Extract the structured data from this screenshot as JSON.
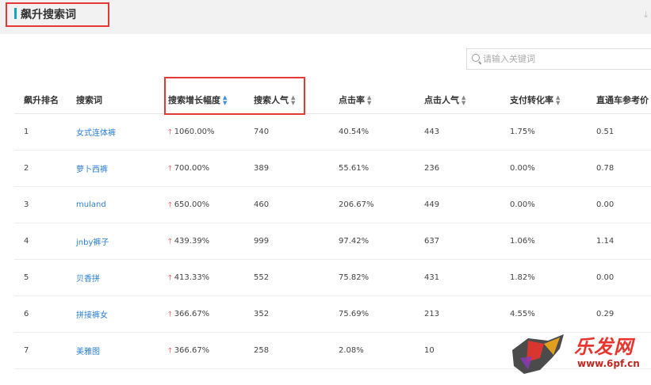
{
  "header": {
    "title": "飙升搜索词"
  },
  "search": {
    "placeholder": "请输入关键词"
  },
  "table": {
    "columns": [
      "飙升排名",
      "搜索词",
      "搜索增长幅度",
      "搜索人气",
      "点击率",
      "点击人气",
      "支付转化率",
      "直通车参考价"
    ],
    "rows": [
      [
        "1",
        "女式连体裤",
        "1060.00%",
        "740",
        "40.54%",
        "443",
        "1.75%",
        "0.51"
      ],
      [
        "2",
        "萝卜西裤",
        "700.00%",
        "389",
        "55.61%",
        "236",
        "0.00%",
        "0.78"
      ],
      [
        "3",
        "muland",
        "650.00%",
        "460",
        "206.67%",
        "449",
        "0.00%",
        "0.00"
      ],
      [
        "4",
        "jnby裤子",
        "439.39%",
        "999",
        "97.42%",
        "637",
        "1.06%",
        "1.14"
      ],
      [
        "5",
        "贝香拼",
        "413.33%",
        "552",
        "75.82%",
        "431",
        "1.82%",
        "0.00"
      ],
      [
        "6",
        "拼接裤女",
        "366.67%",
        "352",
        "75.69%",
        "213",
        "4.55%",
        "0.29"
      ],
      [
        "7",
        "美雅图",
        "366.67%",
        "258",
        "2.08%",
        "10",
        "",
        ""
      ]
    ]
  },
  "watermark": {
    "brand": "乐发网",
    "url": "www.6pf.cn"
  },
  "colors": {
    "accent": "#1aa3b8",
    "highlight": "#e53935",
    "link": "#2a7fd4",
    "up": "#e53935"
  }
}
